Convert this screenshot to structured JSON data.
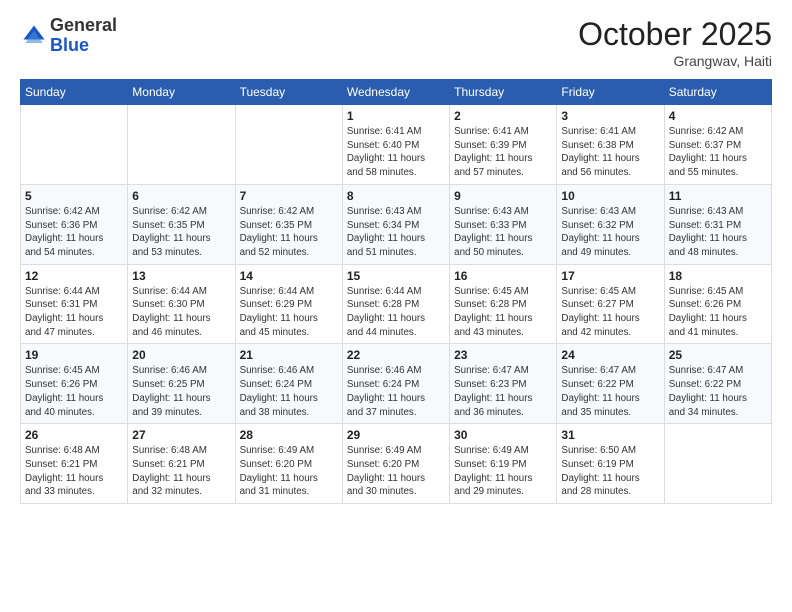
{
  "logo": {
    "general": "General",
    "blue": "Blue"
  },
  "header": {
    "month": "October 2025",
    "location": "Grangwav, Haiti"
  },
  "weekdays": [
    "Sunday",
    "Monday",
    "Tuesday",
    "Wednesday",
    "Thursday",
    "Friday",
    "Saturday"
  ],
  "weeks": [
    [
      {
        "day": "",
        "info": ""
      },
      {
        "day": "",
        "info": ""
      },
      {
        "day": "",
        "info": ""
      },
      {
        "day": "1",
        "info": "Sunrise: 6:41 AM\nSunset: 6:40 PM\nDaylight: 11 hours\nand 58 minutes."
      },
      {
        "day": "2",
        "info": "Sunrise: 6:41 AM\nSunset: 6:39 PM\nDaylight: 11 hours\nand 57 minutes."
      },
      {
        "day": "3",
        "info": "Sunrise: 6:41 AM\nSunset: 6:38 PM\nDaylight: 11 hours\nand 56 minutes."
      },
      {
        "day": "4",
        "info": "Sunrise: 6:42 AM\nSunset: 6:37 PM\nDaylight: 11 hours\nand 55 minutes."
      }
    ],
    [
      {
        "day": "5",
        "info": "Sunrise: 6:42 AM\nSunset: 6:36 PM\nDaylight: 11 hours\nand 54 minutes."
      },
      {
        "day": "6",
        "info": "Sunrise: 6:42 AM\nSunset: 6:35 PM\nDaylight: 11 hours\nand 53 minutes."
      },
      {
        "day": "7",
        "info": "Sunrise: 6:42 AM\nSunset: 6:35 PM\nDaylight: 11 hours\nand 52 minutes."
      },
      {
        "day": "8",
        "info": "Sunrise: 6:43 AM\nSunset: 6:34 PM\nDaylight: 11 hours\nand 51 minutes."
      },
      {
        "day": "9",
        "info": "Sunrise: 6:43 AM\nSunset: 6:33 PM\nDaylight: 11 hours\nand 50 minutes."
      },
      {
        "day": "10",
        "info": "Sunrise: 6:43 AM\nSunset: 6:32 PM\nDaylight: 11 hours\nand 49 minutes."
      },
      {
        "day": "11",
        "info": "Sunrise: 6:43 AM\nSunset: 6:31 PM\nDaylight: 11 hours\nand 48 minutes."
      }
    ],
    [
      {
        "day": "12",
        "info": "Sunrise: 6:44 AM\nSunset: 6:31 PM\nDaylight: 11 hours\nand 47 minutes."
      },
      {
        "day": "13",
        "info": "Sunrise: 6:44 AM\nSunset: 6:30 PM\nDaylight: 11 hours\nand 46 minutes."
      },
      {
        "day": "14",
        "info": "Sunrise: 6:44 AM\nSunset: 6:29 PM\nDaylight: 11 hours\nand 45 minutes."
      },
      {
        "day": "15",
        "info": "Sunrise: 6:44 AM\nSunset: 6:28 PM\nDaylight: 11 hours\nand 44 minutes."
      },
      {
        "day": "16",
        "info": "Sunrise: 6:45 AM\nSunset: 6:28 PM\nDaylight: 11 hours\nand 43 minutes."
      },
      {
        "day": "17",
        "info": "Sunrise: 6:45 AM\nSunset: 6:27 PM\nDaylight: 11 hours\nand 42 minutes."
      },
      {
        "day": "18",
        "info": "Sunrise: 6:45 AM\nSunset: 6:26 PM\nDaylight: 11 hours\nand 41 minutes."
      }
    ],
    [
      {
        "day": "19",
        "info": "Sunrise: 6:45 AM\nSunset: 6:26 PM\nDaylight: 11 hours\nand 40 minutes."
      },
      {
        "day": "20",
        "info": "Sunrise: 6:46 AM\nSunset: 6:25 PM\nDaylight: 11 hours\nand 39 minutes."
      },
      {
        "day": "21",
        "info": "Sunrise: 6:46 AM\nSunset: 6:24 PM\nDaylight: 11 hours\nand 38 minutes."
      },
      {
        "day": "22",
        "info": "Sunrise: 6:46 AM\nSunset: 6:24 PM\nDaylight: 11 hours\nand 37 minutes."
      },
      {
        "day": "23",
        "info": "Sunrise: 6:47 AM\nSunset: 6:23 PM\nDaylight: 11 hours\nand 36 minutes."
      },
      {
        "day": "24",
        "info": "Sunrise: 6:47 AM\nSunset: 6:22 PM\nDaylight: 11 hours\nand 35 minutes."
      },
      {
        "day": "25",
        "info": "Sunrise: 6:47 AM\nSunset: 6:22 PM\nDaylight: 11 hours\nand 34 minutes."
      }
    ],
    [
      {
        "day": "26",
        "info": "Sunrise: 6:48 AM\nSunset: 6:21 PM\nDaylight: 11 hours\nand 33 minutes."
      },
      {
        "day": "27",
        "info": "Sunrise: 6:48 AM\nSunset: 6:21 PM\nDaylight: 11 hours\nand 32 minutes."
      },
      {
        "day": "28",
        "info": "Sunrise: 6:49 AM\nSunset: 6:20 PM\nDaylight: 11 hours\nand 31 minutes."
      },
      {
        "day": "29",
        "info": "Sunrise: 6:49 AM\nSunset: 6:20 PM\nDaylight: 11 hours\nand 30 minutes."
      },
      {
        "day": "30",
        "info": "Sunrise: 6:49 AM\nSunset: 6:19 PM\nDaylight: 11 hours\nand 29 minutes."
      },
      {
        "day": "31",
        "info": "Sunrise: 6:50 AM\nSunset: 6:19 PM\nDaylight: 11 hours\nand 28 minutes."
      },
      {
        "day": "",
        "info": ""
      }
    ]
  ]
}
